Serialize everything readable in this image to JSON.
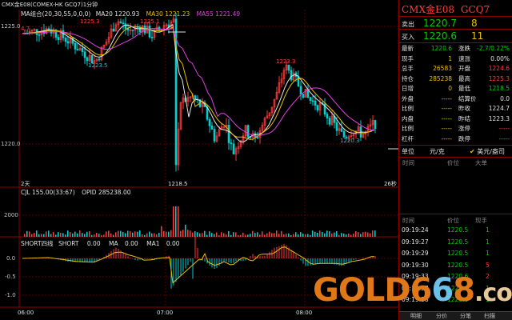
{
  "chart": {
    "header": "CMX金E08(COMEX-HK GCQ7)1分钟",
    "ma_group": "MA组合(20,30,55,0,0,0)",
    "ma20_label": "MA20",
    "ma20_value": "1220.93",
    "ma30_label": "MA30",
    "ma30_value": "1221.23",
    "ma55_label": "MA55",
    "ma55_value": "1221.49",
    "price_ticks": [
      "1225.0",
      "1220.0"
    ],
    "annotations": {
      "left_high": "4.7",
      "high1": "1225.3",
      "high2": "1225.1",
      "low1": "1223.5",
      "peak": "1223.3",
      "low_main": "1218.5",
      "low_right": "1220.3",
      "days_left": "2天",
      "secs_right": "26秒"
    },
    "volume": {
      "header_cjl": "CJL",
      "cjl_value": "155.00(33:67)",
      "opid_label": "OPID",
      "opid_value": "285238.00",
      "tick": "2000"
    },
    "short": {
      "header": "SHORT四线",
      "short_label": "SHORT",
      "short_value": "0.00",
      "ma_label": "MA",
      "ma_value": "0.00",
      "ma1_label": "MA1",
      "ma1_value": "0.00",
      "ticks": [
        "0.0",
        "-0.5",
        "-1.0"
      ]
    },
    "time_axis": [
      "06:00",
      "07:00",
      "08:00"
    ],
    "colors": {
      "up": "#ff3b3b",
      "down": "#00d0d0",
      "ma20": "#e8e8e8",
      "ma30": "#e8c000",
      "ma55": "#e040e0"
    }
  },
  "panel": {
    "title": "CMX金E08",
    "code": "GCQ7",
    "sell_label": "卖出",
    "sell_price": "1220.7",
    "sell_vol": "8",
    "buy_label": "买入",
    "buy_price": "1220.6",
    "buy_vol": "11",
    "quote_rows": [
      {
        "l1": "最新",
        "v1": "1220.6",
        "c1": "green",
        "l2": "涨跌",
        "v2": "-2.7/0.22%",
        "c2": "green"
      },
      {
        "l1": "现手",
        "v1": "1",
        "c1": "yellow",
        "l2": "速涨",
        "v2": "0.00%",
        "c2": "white"
      },
      {
        "l1": "总手",
        "v1": "26583",
        "c1": "yellow",
        "l2": "开盘",
        "v2": "1224.6",
        "c2": "red"
      },
      {
        "l1": "持仓",
        "v1": "285238",
        "c1": "yellow",
        "l2": "最高",
        "v2": "1225.3",
        "c2": "red"
      },
      {
        "l1": "日增",
        "v1": "0",
        "c1": "yellow",
        "l2": "最低",
        "v2": "1218.5",
        "c2": "green"
      },
      {
        "l1": "外盘",
        "v1": "-----",
        "c1": "yellow",
        "l2": "结算价",
        "v2": "0.0",
        "c2": "white"
      },
      {
        "l1": "比例",
        "v1": "-----",
        "c1": "yellow",
        "l2": "昨收",
        "v2": "1224.7",
        "c2": "white"
      },
      {
        "l1": "内盘",
        "v1": "-----",
        "c1": "yellow",
        "l2": "昨结",
        "v2": "1223.3",
        "c2": "white"
      },
      {
        "l1": "比例",
        "v1": "-----",
        "c1": "yellow",
        "l2": "涨停",
        "v2": "-----",
        "c2": "red"
      },
      {
        "l1": "杠杆",
        "v1": "-----",
        "c1": "yellow",
        "l2": "跌停",
        "v2": "-----",
        "c2": "green"
      }
    ],
    "unit_label": "单位",
    "unit_value": "元/克",
    "unit_option": "美元/盎司",
    "list1_headers": [
      "时间",
      "价位",
      "大单"
    ],
    "list2_headers": [
      "时间",
      "价位",
      "现手"
    ],
    "ticks": [
      {
        "time": "09:19:24",
        "price": "1220.5",
        "vol": "1",
        "color": "green"
      },
      {
        "time": "09:19:27",
        "price": "1220.5",
        "vol": "1",
        "color": "green"
      },
      {
        "time": "09:19:29",
        "price": "1220.5",
        "vol": "1",
        "color": "green"
      },
      {
        "time": "09:19:30",
        "price": "1220.5",
        "vol": "5",
        "color": "red"
      },
      {
        "time": "09:19:33",
        "price": "1220.6",
        "vol": "2",
        "color": "red"
      },
      {
        "time": "09:19:37",
        "price": "1220.6",
        "vol": "1",
        "color": "green"
      },
      {
        "time": "09:19:38",
        "price": "1220.6",
        "vol": "1",
        "color": "green"
      }
    ],
    "tabs": [
      "明细",
      "分价",
      "分笔",
      "扫描"
    ]
  },
  "watermark": {
    "part1": "GOLD6",
    "part2": "6",
    "part3": "8",
    "part4": ".com"
  }
}
